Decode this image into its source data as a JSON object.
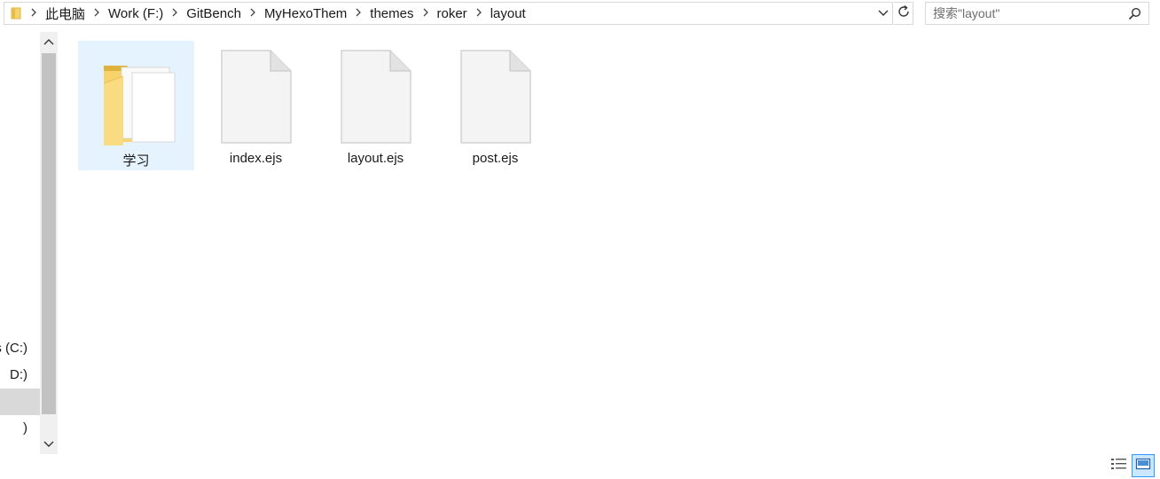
{
  "breadcrumb": {
    "items": [
      "此电脑",
      "Work (F:)",
      "GitBench",
      "MyHexoThem",
      "themes",
      "roker",
      "layout"
    ]
  },
  "search": {
    "placeholder": "搜索\"layout\""
  },
  "nav": {
    "items": [
      {
        "label": "s (C:)",
        "selected": false
      },
      {
        "label": "D:)",
        "selected": false
      },
      {
        "label": "",
        "selected": true
      },
      {
        "label": ")",
        "selected": false
      }
    ]
  },
  "files": [
    {
      "name": "学习",
      "type": "folder",
      "selected": true
    },
    {
      "name": "index.ejs",
      "type": "file",
      "selected": false
    },
    {
      "name": "layout.ejs",
      "type": "file",
      "selected": false
    },
    {
      "name": "post.ejs",
      "type": "file",
      "selected": false
    }
  ],
  "icons": {
    "address_folder": "folder-icon",
    "crumb_separator": "chevron-right-icon",
    "dropdown": "chevron-down-icon",
    "refresh": "refresh-icon",
    "search": "search-icon",
    "scroll_up": "chevron-up-icon",
    "scroll_down": "chevron-down-icon",
    "details_view": "details-view-icon",
    "large_icons_view": "large-icons-view-icon"
  },
  "colors": {
    "selection_bg": "#e5f3ff",
    "nav_selected_bg": "#d9d9d9",
    "active_view_border": "#3399ff",
    "folder_yellow": "#f6d36b"
  }
}
